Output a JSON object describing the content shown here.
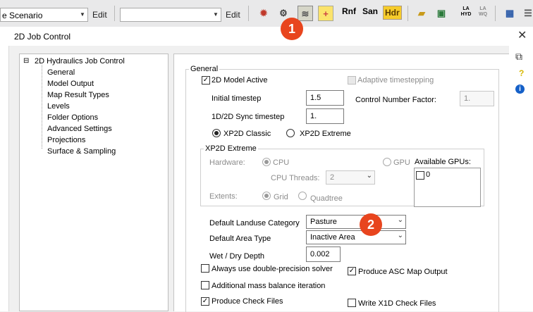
{
  "toolbar": {
    "scenario_combo": "e Scenario",
    "edit1": "Edit",
    "second_combo": "",
    "edit2": "Edit",
    "rnf": "Rnf",
    "san": "San",
    "hdr": "Hdr",
    "la_hyd": "LA HYD",
    "la_wq": "LA WQ"
  },
  "badges": {
    "one": "1",
    "two": "2"
  },
  "dialog": {
    "title": "2D Job Control",
    "close": "✕"
  },
  "tree": {
    "root": "2D Hydraulics Job Control",
    "items": [
      "General",
      "Model Output",
      "Map Result Types",
      "Levels",
      "Folder Options",
      "Advanced Settings",
      "Projections",
      "Surface & Sampling"
    ]
  },
  "general": {
    "group": "General",
    "model_active": "2D Model Active",
    "adaptive": "Adaptive timestepping",
    "initial_timestep_label": "Initial timestep",
    "initial_timestep": "1.5",
    "control_factor_label": "Control Number Factor:",
    "control_factor": "1.",
    "sync_label": "1D/2D Sync timestep",
    "sync": "1.",
    "classic": "XP2D Classic",
    "extreme": "XP2D Extreme"
  },
  "extreme": {
    "group": "XP2D Extreme",
    "hardware": "Hardware:",
    "cpu": "CPU",
    "gpu": "GPU",
    "threads_label": "CPU Threads:",
    "threads": "2",
    "gpus_label": "Available GPUs:",
    "gpu_item": "0",
    "extents": "Extents:",
    "grid": "Grid",
    "quadtree": "Quadtree"
  },
  "lower": {
    "landuse_label": "Default Landuse Category",
    "landuse": "Pasture",
    "area_label": "Default Area Type",
    "area": "Inactive Area",
    "wetdry_label": "Wet / Dry Depth",
    "wetdry": "0.002",
    "double_precision": "Always use double-precision solver",
    "asc_output": "Produce ASC Map Output",
    "mass_balance": "Additional mass balance iteration",
    "check_files": "Produce Check Files",
    "x1d_check": "Write X1D Check Files"
  },
  "sidebar": {
    "help": "?",
    "info": "i"
  }
}
